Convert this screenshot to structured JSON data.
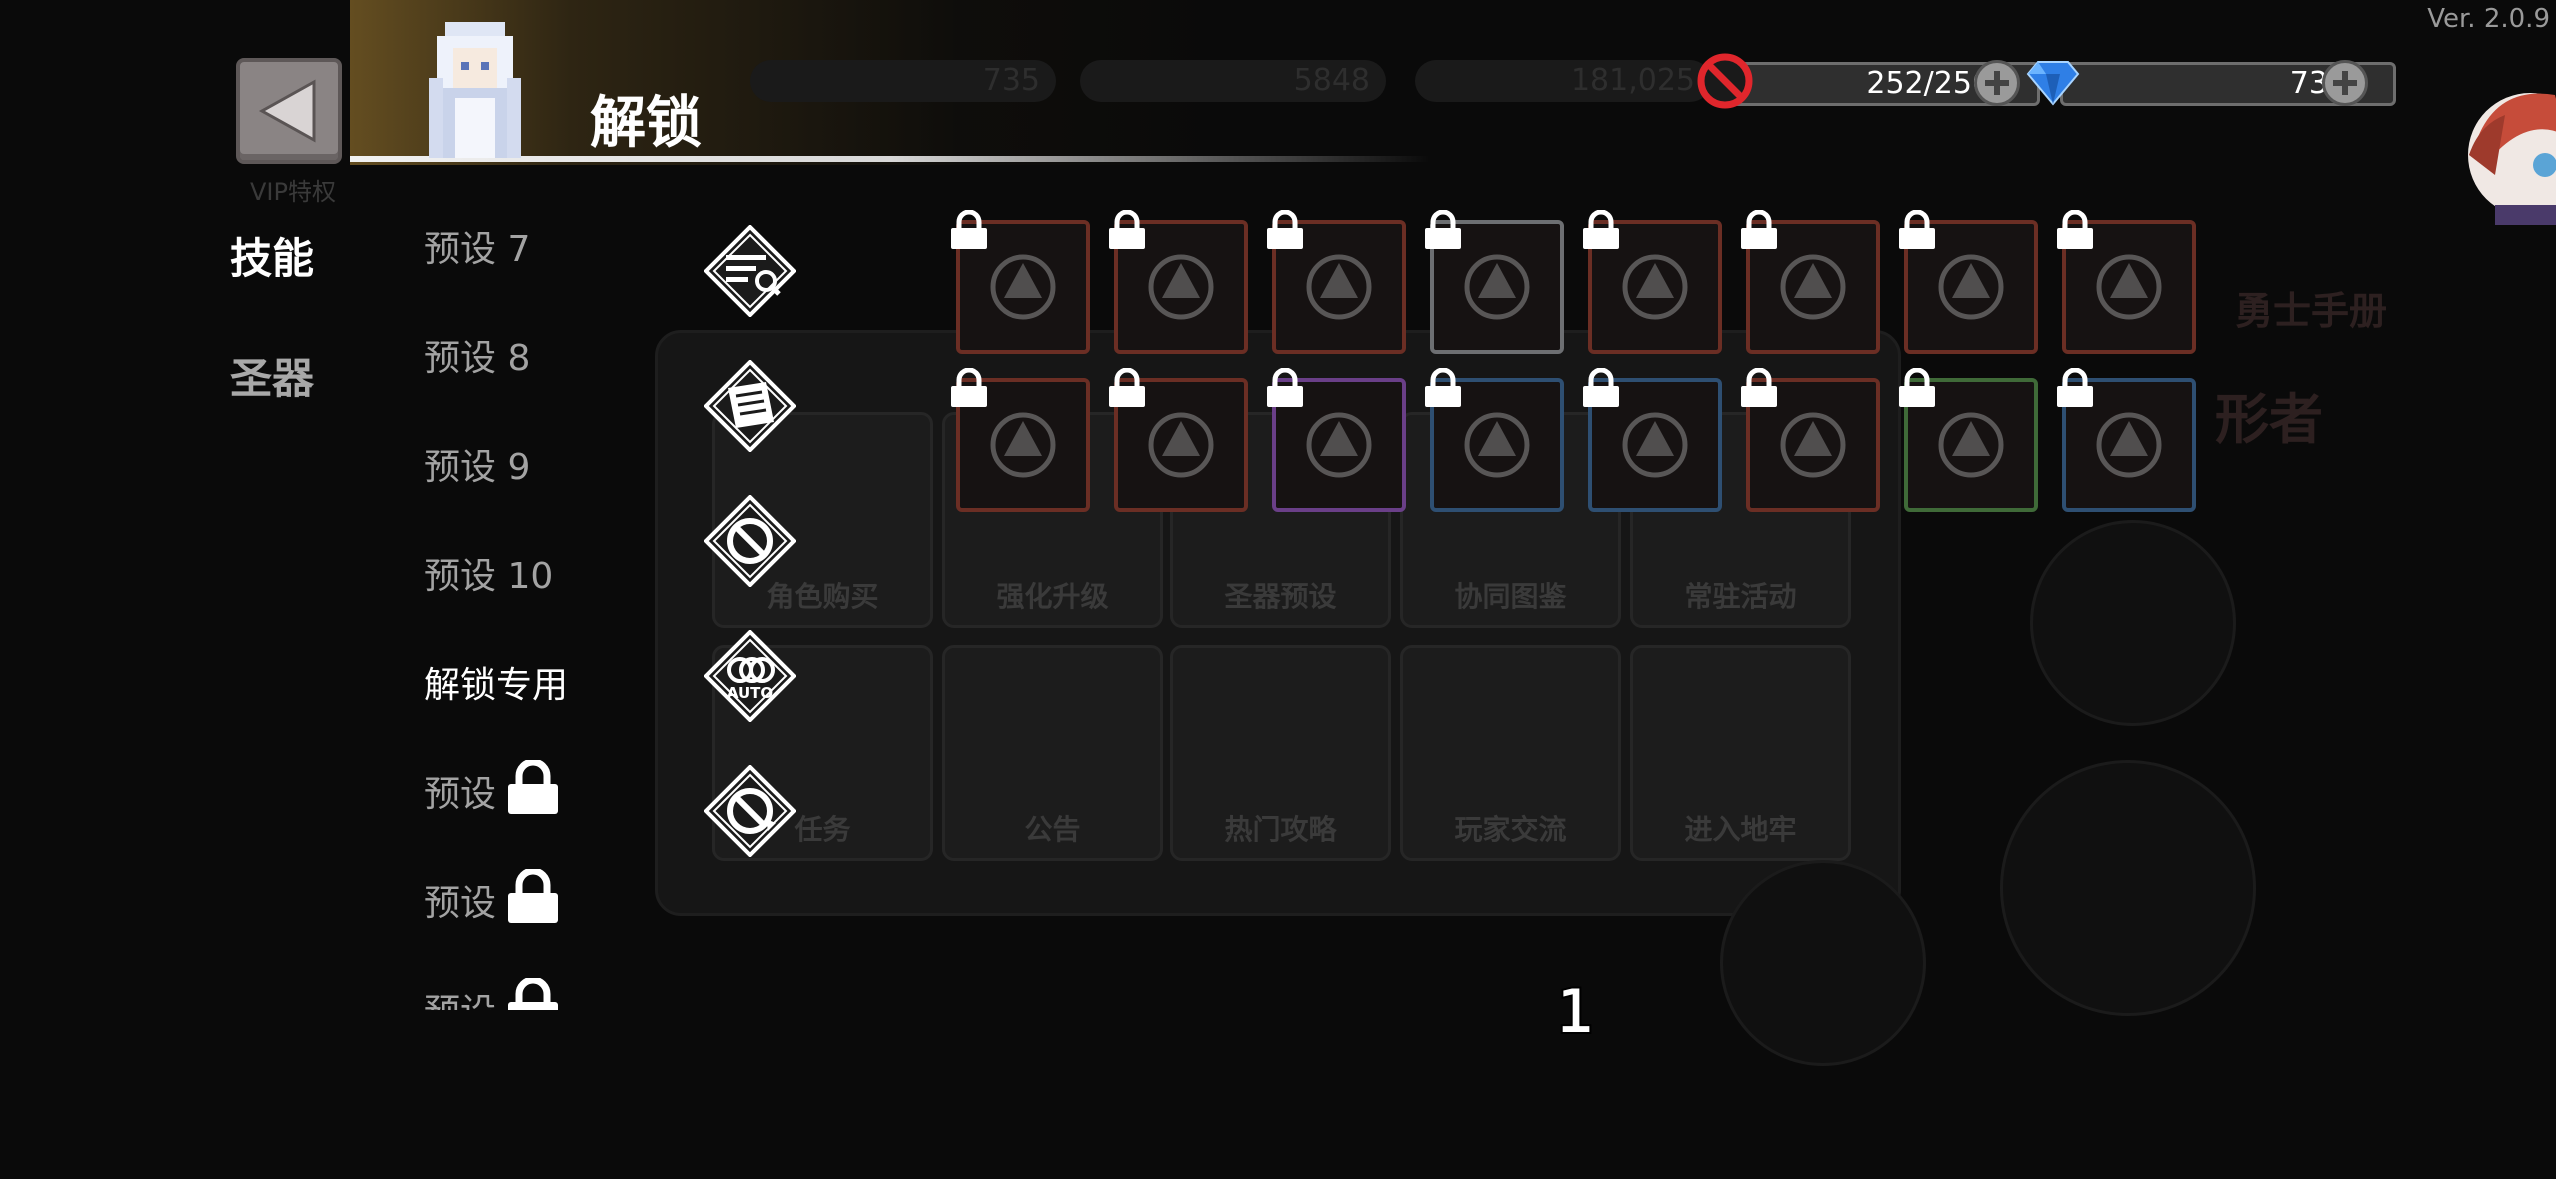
{
  "version": "Ver. 2.0.9",
  "header": {
    "title": "解锁",
    "back_caption": "VIP特权"
  },
  "resources": {
    "faded_1": "735",
    "faded_2": "5848",
    "faded_3": "181,025",
    "energy": {
      "value": "252/256",
      "icon": "no-entry-icon"
    },
    "gems": {
      "value": "735",
      "icon": "diamond-icon"
    }
  },
  "categories": [
    {
      "label": "技能",
      "active": true
    },
    {
      "label": "圣器",
      "active": false
    }
  ],
  "presets": [
    {
      "label": "预设 7",
      "locked": false,
      "selected": false
    },
    {
      "label": "预设 8",
      "locked": false,
      "selected": false
    },
    {
      "label": "预设 9",
      "locked": false,
      "selected": false
    },
    {
      "label": "预设 10",
      "locked": false,
      "selected": false
    },
    {
      "label": "解锁专用",
      "locked": false,
      "selected": true
    },
    {
      "label": "预设",
      "locked": true,
      "selected": false
    },
    {
      "label": "预设",
      "locked": true,
      "selected": false
    },
    {
      "label": "预设",
      "locked": true,
      "selected": false
    }
  ],
  "actions": [
    {
      "name": "filter-search-button",
      "icon": "list-search-icon"
    },
    {
      "name": "scroll-button",
      "icon": "scroll-icon"
    },
    {
      "name": "disable-button",
      "icon": "no-entry-icon"
    },
    {
      "name": "auto-button",
      "icon": "auto-rings-icon",
      "text": "AUTO"
    },
    {
      "name": "refresh-button",
      "icon": "refresh-icon"
    }
  ],
  "skills": [
    [
      {
        "icon": "crystal-shard-icon",
        "border": "#6b2e24"
      },
      {
        "icon": "frost-sword-icon",
        "border": "#6b2e24"
      },
      {
        "icon": "vortex-icon",
        "border": "#6b2e24"
      },
      {
        "icon": "winged-orb-icon",
        "border": "#6d6f72"
      },
      {
        "icon": "thorn-branch-icon",
        "border": "#6b2e24"
      },
      {
        "icon": "flame-cloud-icon",
        "border": "#6b2e24"
      },
      {
        "icon": "lightning-stopwatch-icon",
        "border": "#6b2e24"
      },
      {
        "icon": "spear-icon",
        "border": "#6b2e24"
      }
    ],
    [
      {
        "icon": "fireball-icon",
        "border": "#6b2e24"
      },
      {
        "icon": "spikes-icon",
        "border": "#6b2e24"
      },
      {
        "icon": "sun-gear-icon",
        "border": "#6a3f88"
      },
      {
        "icon": "shield-emblem-icon",
        "border": "#2e4f72"
      },
      {
        "icon": "spinning-disc-icon",
        "border": "#2e4f72"
      },
      {
        "icon": "shuriken-icon",
        "border": "#6b2e24"
      },
      {
        "icon": "gauntlet-icon",
        "border": "#3f6a38"
      },
      {
        "icon": "dark-heart-icon",
        "border": "#2e4f72"
      }
    ]
  ],
  "background_tiles": [
    "角色购买",
    "强化升级",
    "圣器预设",
    "协同图鉴",
    "常驻活动",
    "任务",
    "公告",
    "热门攻略",
    "玩家交流",
    "进入地牢"
  ],
  "background_side_text": [
    "勇士手册",
    "形者"
  ],
  "page_number": "1"
}
